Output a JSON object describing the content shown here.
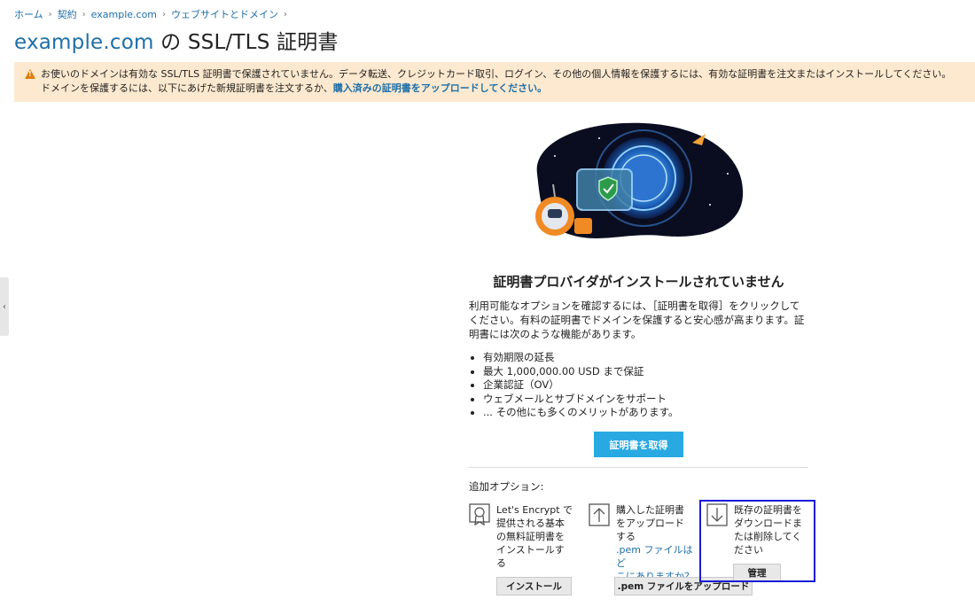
{
  "breadcrumb": {
    "items": [
      "ホーム",
      "契約",
      "example.com",
      "ウェブサイトとドメイン"
    ]
  },
  "page": {
    "title_domain": "example.com",
    "title_rest": " の SSL/TLS 証明書"
  },
  "warning": {
    "line1": "お使いのドメインは有効な SSL/TLS 証明書で保護されていません。データ転送、クレジットカード取引、ログイン、その他の個人情報を保護するには、有効な証明書を注文またはインストールしてください。",
    "line2_prefix": "ドメインを保護するには、以下にあげた新規証明書を注文するか、",
    "line2_link": "購入済みの証明書をアップロードしてください。"
  },
  "empty_state": {
    "title": "証明書プロバイダがインストールされていません",
    "description": "利用可能なオプションを確認するには、［証明書を取得］をクリックしてください。有料の証明書でドメインを保護すると安心感が高まります。証明書には次のような機能があります。",
    "features": [
      "有効期限の延長",
      "最大 1,000,000.00 USD まで保証",
      "企業認証（OV）",
      "ウェブメールとサブドメインをサポート",
      "... その他にも多くのメリットがあります。"
    ],
    "get_button": "証明書を取得"
  },
  "more_options": {
    "label": "追加オプション:",
    "letsencrypt": {
      "lines": [
        "Let's Encrypt で",
        "提供される基本",
        "の無料証明書を",
        "インストールす",
        "る"
      ],
      "button": "インストール"
    },
    "upload": {
      "lines": [
        "購入した証明書",
        "をアップロード",
        "する"
      ],
      "link_lines": [
        ".pem ファイルはど",
        "こにありますか？"
      ],
      "button": ".pem ファイルをアップロード"
    },
    "manage": {
      "lines": [
        "既存の証明書を",
        "ダウンロードま",
        "たは削除してく",
        "ださい"
      ],
      "button": "管理"
    }
  },
  "colors": {
    "link": "#1e6fa8",
    "primary_button": "#28a9e2",
    "warning_bg": "#fde9cf",
    "warning_icon": "#e07b00",
    "highlight": "#1a1ad8"
  },
  "icons": {
    "warning": "warning-triangle-icon",
    "letsencrypt": "certificate-badge-icon",
    "upload": "upload-arrow-icon",
    "manage": "download-arrow-icon",
    "sidebar_toggle": "chevron-left-icon"
  }
}
